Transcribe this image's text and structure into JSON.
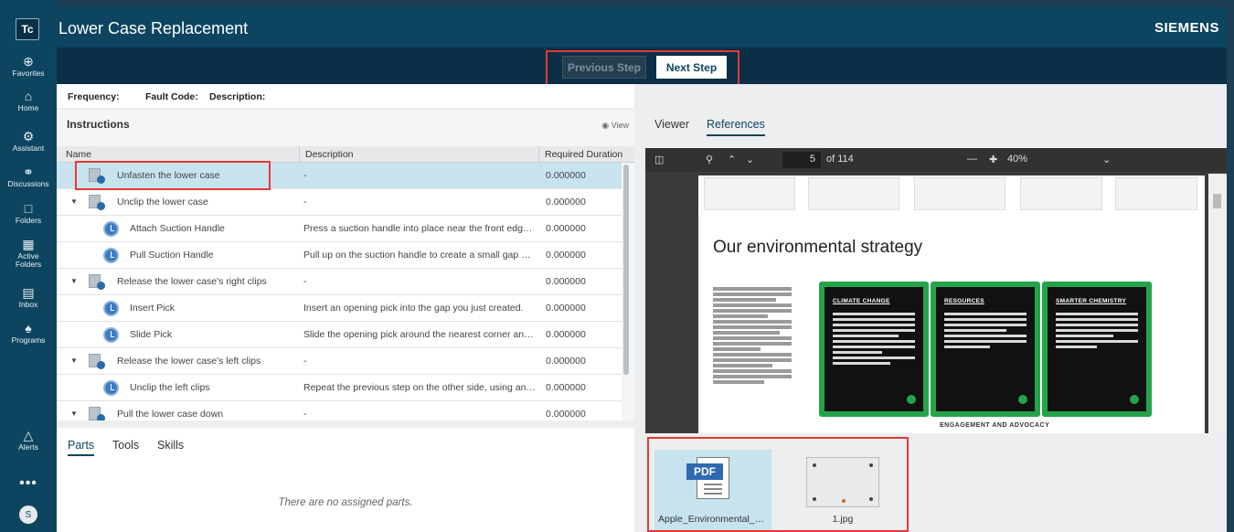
{
  "app": {
    "logo_text": "Tc",
    "title": "Lower Case Replacement",
    "brand": "SIEMENS"
  },
  "rail": {
    "items": [
      {
        "label": "Favorites",
        "icon": "favorites-icon"
      },
      {
        "label": "Home",
        "icon": "home-icon"
      },
      {
        "label": "Assistant",
        "icon": "assistant-icon"
      },
      {
        "label": "Discussions",
        "icon": "discussions-icon"
      },
      {
        "label": "Folders",
        "icon": "folders-icon"
      },
      {
        "label": "Active Folders",
        "icon": "active-folders-icon"
      },
      {
        "label": "Inbox",
        "icon": "inbox-icon"
      },
      {
        "label": "Programs",
        "icon": "programs-icon"
      }
    ],
    "alerts_label": "Alerts",
    "more_label": "•••",
    "avatar_initial": "S"
  },
  "steps": {
    "previous_label": "Previous Step",
    "next_label": "Next Step"
  },
  "info": {
    "frequency_label": "Frequency:",
    "fault_code_label": "Fault Code:",
    "description_label": "Description:"
  },
  "instructions": {
    "title": "Instructions",
    "view_label": "View",
    "columns": [
      "Name",
      "Description",
      "Required Duration"
    ],
    "rows": [
      {
        "name": "Unfasten the lower case",
        "desc": "-",
        "dur": "0.000000",
        "kind": "task",
        "expand": ""
      },
      {
        "name": "Unclip the lower case",
        "desc": "-",
        "dur": "0.000000",
        "kind": "task",
        "expand": "▼"
      },
      {
        "name": "Attach Suction Handle",
        "desc": "Press a suction handle into place near the front edge of the lower case.",
        "dur": "0.000000",
        "kind": "step",
        "expand": ""
      },
      {
        "name": "Pull Suction Handle",
        "desc": "Pull up on the suction handle to create a small gap under the case.",
        "dur": "0.000000",
        "kind": "step",
        "expand": ""
      },
      {
        "name": "Release the lower case's right clips",
        "desc": "-",
        "dur": "0.000000",
        "kind": "task",
        "expand": "▼"
      },
      {
        "name": "Insert Pick",
        "desc": "Insert an opening pick into the gap you just created.",
        "dur": "0.000000",
        "kind": "step",
        "expand": ""
      },
      {
        "name": "Slide Pick",
        "desc": "Slide the opening pick around the nearest corner and along the side.",
        "dur": "0.000000",
        "kind": "step",
        "expand": ""
      },
      {
        "name": "Release the lower case's left clips",
        "desc": "-",
        "dur": "0.000000",
        "kind": "task",
        "expand": "▼"
      },
      {
        "name": "Unclip the left clips",
        "desc": "Repeat the previous step on the other side, using an opening pick.",
        "dur": "0.000000",
        "kind": "step",
        "expand": ""
      },
      {
        "name": "Pull the lower case down",
        "desc": "-",
        "dur": "0.000000",
        "kind": "task",
        "expand": "▼"
      }
    ]
  },
  "parts": {
    "tabs": [
      "Parts",
      "Tools",
      "Skills"
    ],
    "empty_text": "There are no assigned parts."
  },
  "viewer": {
    "tabs": [
      "Viewer",
      "References"
    ],
    "page_current": "5",
    "page_total": "of 114",
    "zoom": "40%",
    "doc_heading": "Our environmental strategy",
    "cards": [
      "CLIMATE CHANGE",
      "RESOURCES",
      "SMARTER CHEMISTRY"
    ],
    "footer_label": "ENGAGEMENT AND ADVOCACY",
    "files": [
      {
        "name": "Apple_Environmental_Progress_Report.pdf",
        "type": "PDF"
      },
      {
        "name": "1.jpg",
        "type": "JPG"
      }
    ]
  },
  "colors": {
    "nav_bg": "#0d4560",
    "step_bar_bg": "#0b2f47",
    "highlight": "#e53935",
    "selected_row": "#c7e3ee",
    "pdf_card_border": "#24a44a"
  }
}
